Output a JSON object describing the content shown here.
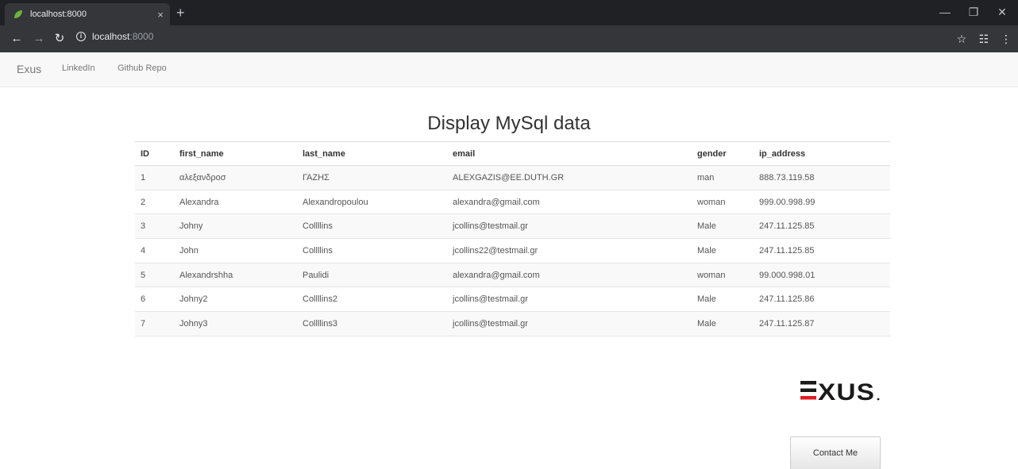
{
  "browser": {
    "tab_title": "localhost:8000",
    "tab_close": "×",
    "new_tab": "+",
    "url_host": "localhost",
    "url_port": ":8000"
  },
  "navbar": {
    "brand": "Exus",
    "links": [
      "LinkedIn",
      "Github Repo"
    ]
  },
  "page": {
    "title": "Display MySql data"
  },
  "table": {
    "headers": [
      "ID",
      "first_name",
      "last_name",
      "email",
      "gender",
      "ip_address"
    ],
    "rows": [
      [
        "1",
        "αλεξανδροσ",
        "ΓΑΖΗΣ",
        "ALEXGAZIS@EE.DUTH.GR",
        "man",
        "888.73.119.58"
      ],
      [
        "2",
        "Alexandra",
        "Alexandropoulou",
        "alexandra@gmail.com",
        "woman",
        "999.00.998.99"
      ],
      [
        "3",
        "Johny",
        "Collllins",
        "jcollins@testmail.gr",
        "Male",
        "247.11.125.85"
      ],
      [
        "4",
        "John",
        "Collllins",
        "jcollins22@testmail.gr",
        "Male",
        "247.11.125.85"
      ],
      [
        "5",
        "Alexandrshha",
        "Paulidi",
        "alexandra@gmail.com",
        "woman",
        "99.000.998.01"
      ],
      [
        "6",
        "Johny2",
        "Collllins2",
        "jcollins@testmail.gr",
        "Male",
        "247.11.125.86"
      ],
      [
        "7",
        "Johny3",
        "Collllins3",
        "jcollins@testmail.gr",
        "Male",
        "247.11.125.87"
      ]
    ]
  },
  "logo_text": "EXUS",
  "contact_label": "Contact Me",
  "colors": {
    "logo_dark": "#1a1a1a",
    "logo_accent": "#e21b23",
    "chrome_dark": "#202124",
    "chrome_toolbar": "#35363a",
    "navbar_bg": "#f8f8f8"
  }
}
